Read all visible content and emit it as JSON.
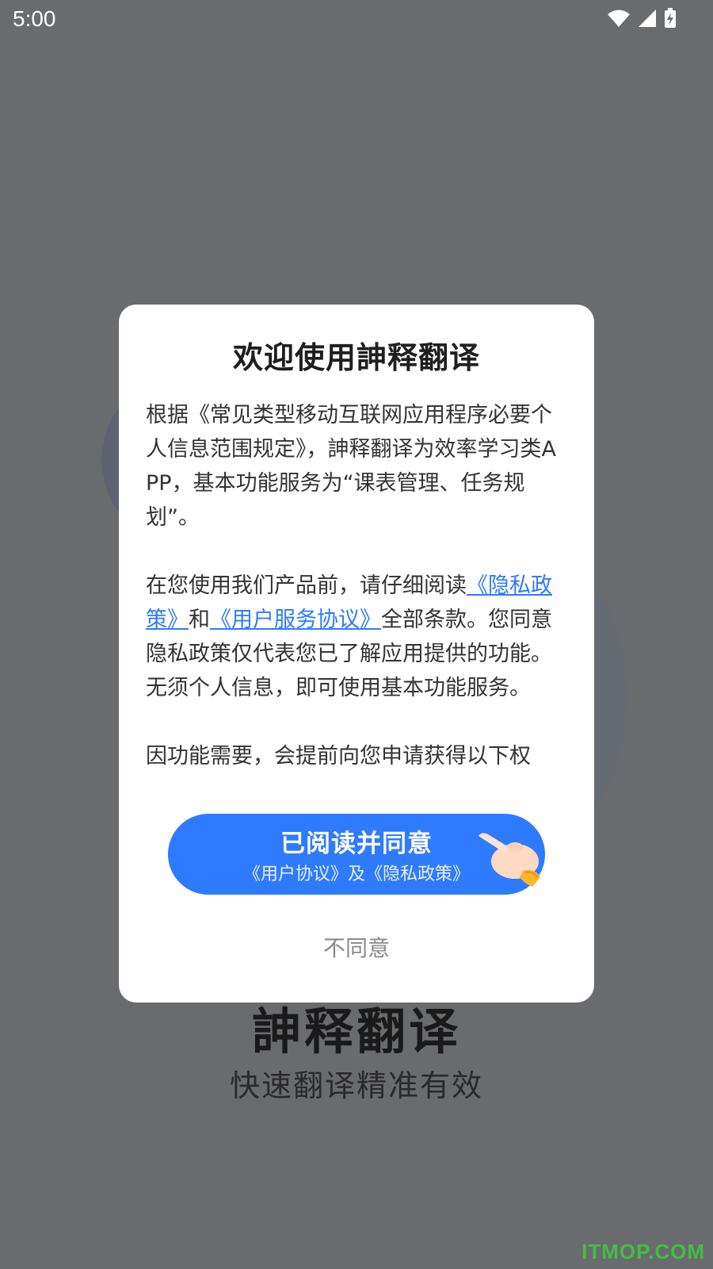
{
  "status_bar": {
    "time": "5:00"
  },
  "splash": {
    "app_name": "訷释翻译",
    "slogan": "快速翻译精准有效"
  },
  "dialog": {
    "title": "欢迎使用訷释翻译",
    "paragraph1": "根据《常见类型移动互联网应用程序必要个人信息范围规定》，訷释翻译为效率学习类APP，基本功能服务为“课表管理、任务规划”。",
    "paragraph2": {
      "part1": "在您使用我们产品前，请仔细阅读",
      "privacy_link": "《隐私政策》",
      "part2": "和",
      "agreement_link": "《用户服务协议》",
      "part3": "全部条款。您同意隐私政策仅代表您已了解应用提供的功能。无须个人信息，即可使用基本功能服务。"
    },
    "paragraph3_partial": "因功能需要，会提前向您申请获得以下权",
    "agree_button": {
      "main_label": "已阅读并同意",
      "sub_label": "《用户协议》及《隐私政策》"
    },
    "disagree_label": "不同意"
  },
  "watermark": "ITMOP.COM",
  "colors": {
    "accent": "#2f7bff",
    "overlay": "#6b6c6f",
    "dialog_bg": "#ffffff"
  }
}
